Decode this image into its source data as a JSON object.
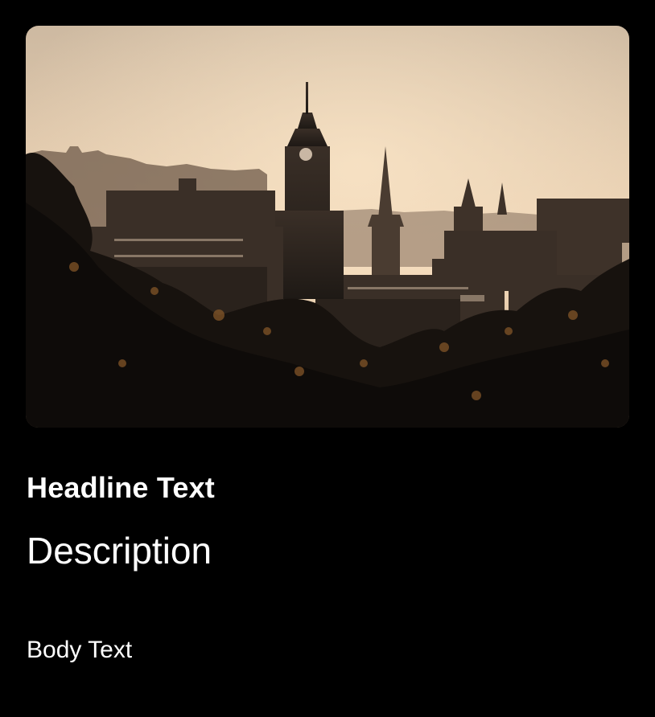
{
  "card": {
    "image_alt": "City skyline at sunset with clock tower and spires",
    "headline": "Headline Text",
    "description": "Description",
    "body": "Body Text"
  },
  "colors": {
    "background": "#000000",
    "text": "#ffffff",
    "sky_top": "#d9c3a6",
    "sky_bottom": "#efd4b4",
    "silhouette": "#2a221c"
  }
}
